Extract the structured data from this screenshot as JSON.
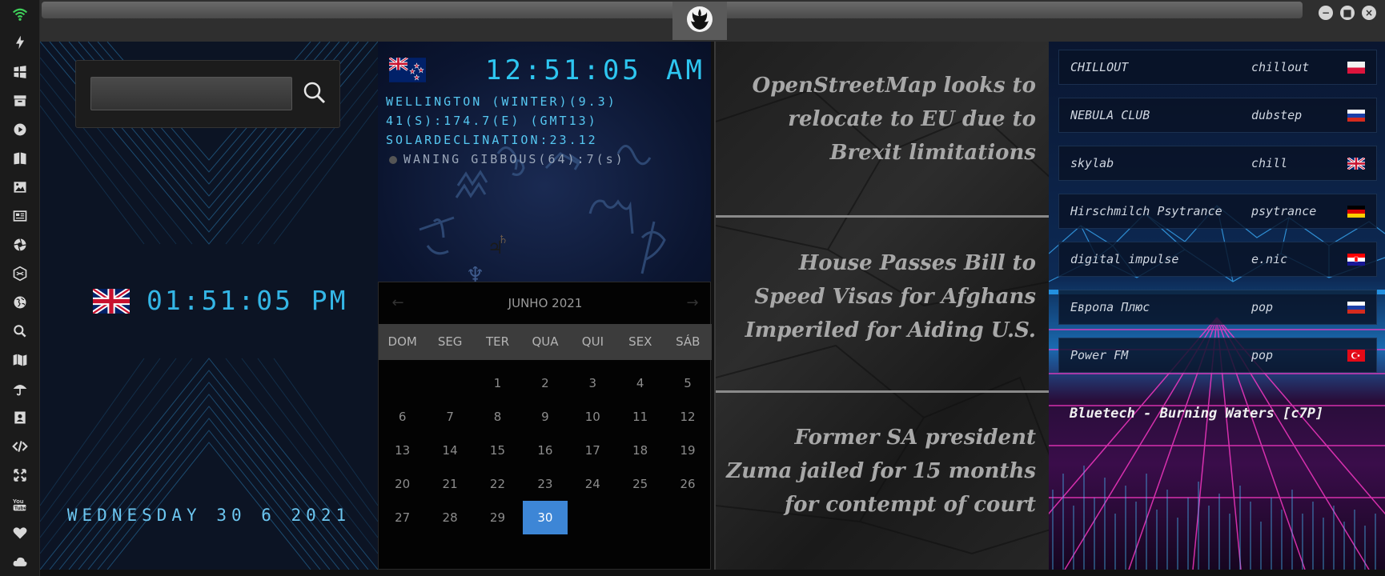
{
  "sidebar": {
    "icons": [
      "wifi-icon",
      "lightning-icon",
      "windows-icon",
      "archive-icon",
      "play-icon",
      "book-icon",
      "image-icon",
      "news-icon",
      "aperture-icon",
      "hexagon-icon",
      "globe-icon",
      "search-icon",
      "map-icon",
      "umbrella-icon",
      "contacts-icon",
      "code-icon",
      "expand-icon",
      "youtube-icon",
      "heart-icon",
      "cloud-icon"
    ],
    "accent_color": "#3fcf5a"
  },
  "clock_panel": {
    "search": {
      "value": "",
      "placeholder": ""
    },
    "local_time": "01:51:05 PM",
    "local_date": "WEDNESDAY 30 6 2021",
    "flag": "uk"
  },
  "world_clock": {
    "time": "12:51:05",
    "ampm": "AM",
    "flag": "nz",
    "line1": "WELLINGTON (WINTER)(9.3)",
    "line2": "41(S):174.7(E) (GMT13)",
    "line3": "SOLARDECLINATION:23.12",
    "moon": "WANING GIBBOUS(64):7(s)"
  },
  "calendar": {
    "month_label": "JUNHO 2021",
    "prev_label": "←",
    "next_label": "→",
    "weekdays": [
      "DOM",
      "SEG",
      "TER",
      "QUA",
      "QUI",
      "SEX",
      "SÁB"
    ],
    "leading_blanks": 2,
    "days": [
      "1",
      "2",
      "3",
      "4",
      "5",
      "6",
      "7",
      "8",
      "9",
      "10",
      "11",
      "12",
      "13",
      "14",
      "15",
      "16",
      "17",
      "18",
      "19",
      "20",
      "21",
      "22",
      "23",
      "24",
      "25",
      "26",
      "27",
      "28",
      "29",
      "30"
    ],
    "selected_day": "30",
    "selected_color": "#3d86d6"
  },
  "news": {
    "items": [
      {
        "title": "OpenStreetMap looks to relocate to EU due to Brexit limitations"
      },
      {
        "title": "House Passes Bill to Speed Visas for Afghans Imperiled for Aiding U.S."
      },
      {
        "title": "Former SA president Zuma jailed for 15 months for contempt of court"
      }
    ]
  },
  "radio": {
    "stations": [
      {
        "name": "CHILLOUT",
        "genre": "chillout",
        "flag": "pl"
      },
      {
        "name": "NEBULA CLUB",
        "genre": "dubstep",
        "flag": "ru"
      },
      {
        "name": "skylab",
        "genre": "chill",
        "flag": "gb"
      },
      {
        "name": "Hirschmilch Psytrance",
        "genre": "psytrance",
        "flag": "de"
      },
      {
        "name": "digital impulse",
        "genre": "e.nic",
        "flag": "hr"
      },
      {
        "name": "Европа Плюс",
        "genre": "pop",
        "flag": "ru"
      },
      {
        "name": "Power FM",
        "genre": "pop",
        "flag": "tr"
      }
    ],
    "now_playing": "Bluetech - Burning Waters [c7P]"
  }
}
